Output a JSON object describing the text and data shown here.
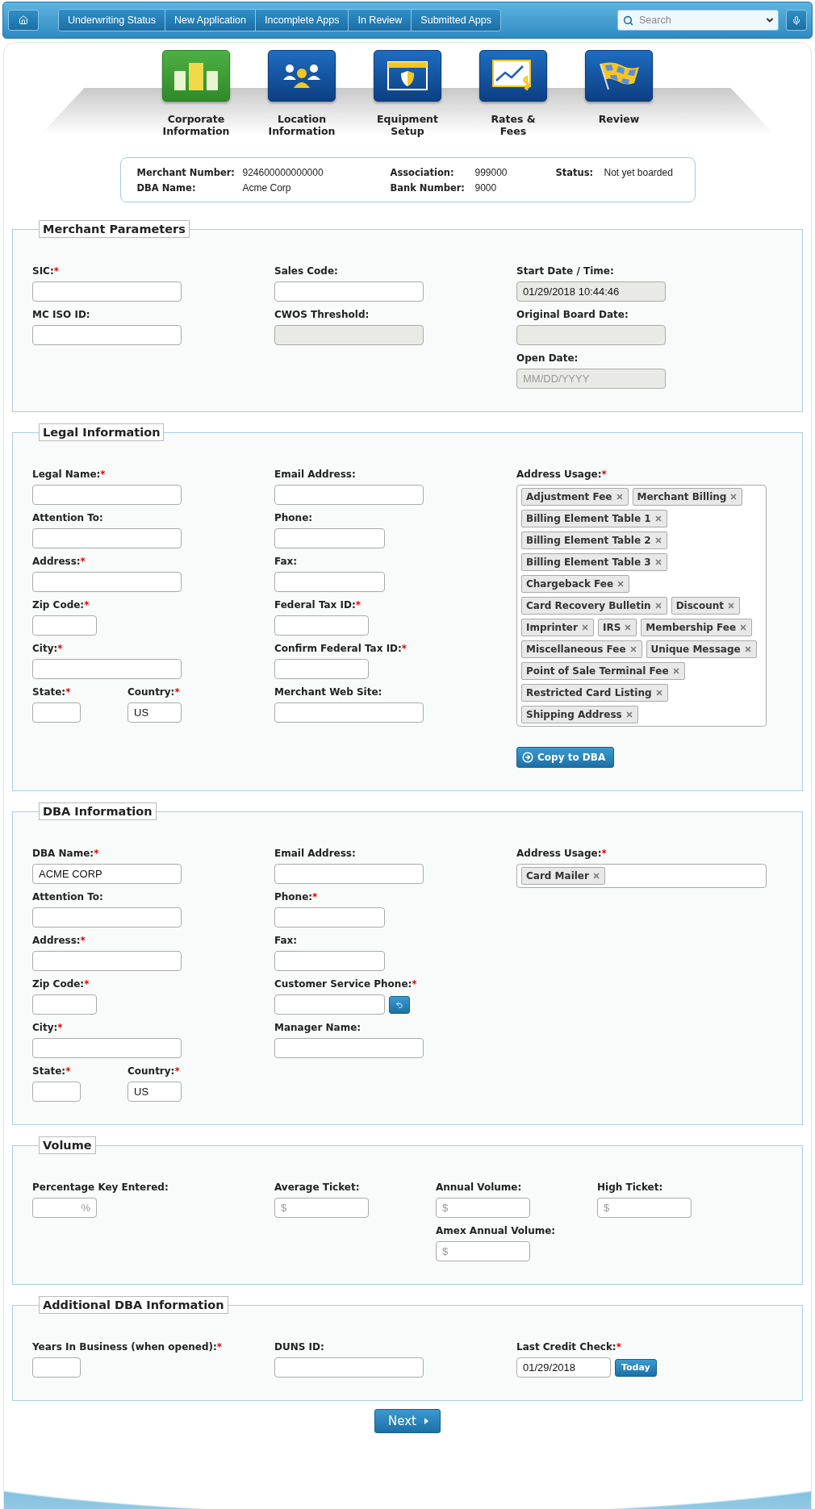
{
  "nav": {
    "tabs": [
      {
        "label": "Underwriting Status"
      },
      {
        "label": "New Application"
      },
      {
        "label": "Incomplete Apps"
      },
      {
        "label": "In Review"
      },
      {
        "label": "Submitted Apps"
      }
    ],
    "search": {
      "placeholder": "Search"
    }
  },
  "steps": [
    {
      "label": "Corporate\nInformation",
      "selected": true
    },
    {
      "label": "Location\nInformation",
      "selected": false
    },
    {
      "label": "Equipment\nSetup",
      "selected": false
    },
    {
      "label": "Rates &\nFees",
      "selected": false
    },
    {
      "label": "Review",
      "selected": false
    }
  ],
  "summary": {
    "rows": [
      [
        {
          "label": "Merchant Number:",
          "value": "924600000000000"
        },
        {
          "label": "Association:",
          "value": "999000"
        },
        {
          "label": "Status:",
          "value": "Not yet boarded"
        }
      ],
      [
        {
          "label": "DBA Name:",
          "value": "Acme Corp"
        },
        {
          "label": "Bank Number:",
          "value": "9000"
        }
      ]
    ]
  },
  "sections": [
    {
      "title": "Merchant Parameters",
      "columns": [
        [
          {
            "kind": "wide",
            "label": "SIC:",
            "mark": "*",
            "disabled": false
          },
          {
            "kind": "wide",
            "label": "MC ISO ID:",
            "disabled": false
          }
        ],
        [
          {
            "kind": "wide",
            "label": "Sales Code:",
            "disabled": false
          },
          {
            "kind": "wide",
            "label": "CWOS Threshold:",
            "disabled": true
          }
        ],
        [
          {
            "kind": "wide",
            "label": "Start Date / Time:",
            "disabled": true,
            "value": "01/29/2018 10:44:46"
          },
          {
            "kind": "wide",
            "label": "Original Board Date:",
            "disabled": true
          },
          {
            "kind": "wide",
            "label": "Open Date:",
            "disabled": true,
            "placeholder": "MM/DD/YYYY"
          }
        ]
      ]
    },
    {
      "title": "Legal Information",
      "columns": [
        [
          {
            "kind": "wide",
            "label": "Legal Name:",
            "mark": "*",
            "disabled": false
          },
          {
            "kind": "wide",
            "label": "Attention To:",
            "disabled": false
          },
          {
            "kind": "wide",
            "label": "Address:",
            "mark": "*",
            "disabled": false
          },
          {
            "kind": "small",
            "label": "Zip Code:",
            "mark": "*",
            "disabled": false
          },
          {
            "kind": "wide",
            "label": "City:",
            "mark": "*",
            "disabled": false
          },
          {
            "kind": "pair",
            "fields": [
              {
                "kind": "tiny",
                "label": "State:",
                "mark": "*",
                "disabled": false
              },
              {
                "kind": "narrow",
                "label": "Country:",
                "mark": "*",
                "disabled": false,
                "value": "US"
              }
            ]
          }
        ],
        [
          {
            "kind": "wide",
            "label": "Email Address:",
            "disabled": false
          },
          {
            "kind": "medium",
            "label": "Phone:",
            "disabled": false
          },
          {
            "kind": "medium",
            "label": "Fax:",
            "disabled": false
          },
          {
            "kind": "short",
            "label": "Federal Tax ID:",
            "mark": "*",
            "disabled": false
          },
          {
            "kind": "short",
            "label": "Confirm Federal Tax ID:",
            "mark": "*",
            "disabled": false
          },
          {
            "kind": "wide",
            "label": "Merchant Web Site:",
            "disabled": false
          }
        ],
        [
          {
            "kind": "tags",
            "label": "Address Usage:",
            "mark": "*",
            "tags": [
              "Adjustment Fee",
              "Merchant Billing",
              "Billing Element Table 1",
              "Billing Element Table 2",
              "Billing Element Table 3",
              "Chargeback Fee",
              "Card Recovery Bulletin",
              "Discount",
              "Imprinter",
              "IRS",
              "Membership Fee",
              "Miscellaneous Fee",
              "Unique Message",
              "Point of Sale Terminal Fee",
              "Restricted Card Listing",
              "Shipping Address"
            ]
          },
          {
            "kind": "button",
            "label": "Copy to DBA"
          }
        ]
      ]
    },
    {
      "title": "DBA Information",
      "columns": [
        [
          {
            "kind": "wide",
            "label": "DBA Name:",
            "mark": "*",
            "disabled": false,
            "value": "ACME CORP"
          },
          {
            "kind": "wide",
            "label": "Attention To:",
            "disabled": false
          },
          {
            "kind": "wide",
            "label": "Address:",
            "mark": "*",
            "disabled": false
          },
          {
            "kind": "small",
            "label": "Zip Code:",
            "mark": "*",
            "disabled": false
          },
          {
            "kind": "wide",
            "label": "City:",
            "mark": "*",
            "disabled": false
          },
          {
            "kind": "pair",
            "fields": [
              {
                "kind": "tiny",
                "label": "State:",
                "mark": "*",
                "disabled": false
              },
              {
                "kind": "narrow",
                "label": "Country:",
                "mark": "*",
                "disabled": false,
                "value": "US"
              }
            ]
          }
        ],
        [
          {
            "kind": "wide",
            "label": "Email Address:",
            "disabled": false
          },
          {
            "kind": "medium",
            "label": "Phone:",
            "mark": "*",
            "disabled": false
          },
          {
            "kind": "medium",
            "label": "Fax:",
            "disabled": false
          },
          {
            "kind": "text_icon",
            "label": "Customer Service Phone:",
            "mark": "*",
            "disabled": false
          },
          {
            "kind": "wide",
            "label": "Manager Name:",
            "disabled": false
          }
        ],
        [
          {
            "kind": "tags",
            "label": "Address Usage:",
            "mark": "*",
            "tags": [
              "Card Mailer"
            ]
          }
        ]
      ]
    },
    {
      "title": "Volume",
      "columns": [
        [
          {
            "kind": "percent",
            "label": "Percentage Key Entered:",
            "disabled": false,
            "placeholder": "%"
          }
        ],
        [
          {
            "kind": "short",
            "label": "Average Ticket:",
            "disabled": false,
            "placeholder": "$"
          }
        ],
        [
          {
            "kind": "short",
            "label": "Annual Volume:",
            "disabled": false,
            "placeholder": "$"
          },
          {
            "kind": "short",
            "label": "Amex Annual Volume:",
            "disabled": false,
            "placeholder": "$"
          }
        ],
        [
          {
            "kind": "short",
            "label": "High Ticket:",
            "disabled": false,
            "placeholder": "$"
          }
        ]
      ]
    },
    {
      "title": "Additional DBA Information",
      "columns": [
        [
          {
            "kind": "tiny",
            "label": "Years In Business (when opened):",
            "mark": "*",
            "disabled": false
          }
        ],
        [
          {
            "kind": "wide",
            "label": "DUNS ID:",
            "disabled": false
          }
        ],
        [
          {
            "kind": "text_button",
            "label": "Last Credit Check:",
            "mark": "*",
            "disabled": false,
            "value": "01/29/2018",
            "button": "Today"
          }
        ]
      ]
    }
  ],
  "next_button": {
    "label": "Next"
  }
}
